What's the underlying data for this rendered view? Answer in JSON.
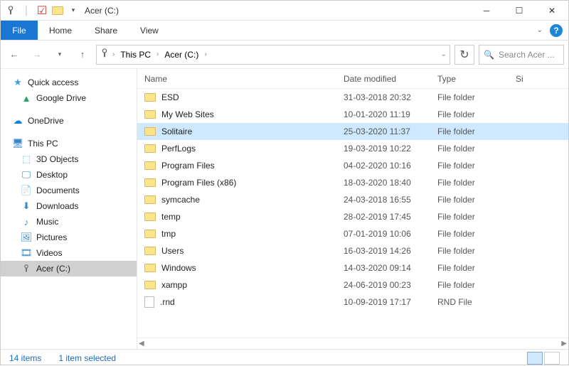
{
  "window": {
    "title": "Acer (C:)"
  },
  "ribbon": {
    "file": "File",
    "tabs": [
      "Home",
      "Share",
      "View"
    ]
  },
  "breadcrumb": {
    "items": [
      "This PC",
      "Acer (C:)"
    ]
  },
  "search": {
    "placeholder": "Search Acer ..."
  },
  "sidebar": {
    "quick_access": "Quick access",
    "google_drive": "Google Drive",
    "onedrive": "OneDrive",
    "this_pc": "This PC",
    "items": [
      "3D Objects",
      "Desktop",
      "Documents",
      "Downloads",
      "Music",
      "Pictures",
      "Videos",
      "Acer (C:)"
    ]
  },
  "columns": {
    "name": "Name",
    "date": "Date modified",
    "type": "Type",
    "size": "Si"
  },
  "files": [
    {
      "name": "ESD",
      "date": "31-03-2018 20:32",
      "type": "File folder",
      "icon": "folder",
      "selected": false
    },
    {
      "name": "My Web Sites",
      "date": "10-01-2020 11:19",
      "type": "File folder",
      "icon": "folder",
      "selected": false
    },
    {
      "name": "Solitaire",
      "date": "25-03-2020 11:37",
      "type": "File folder",
      "icon": "folder",
      "selected": true
    },
    {
      "name": "PerfLogs",
      "date": "19-03-2019 10:22",
      "type": "File folder",
      "icon": "folder",
      "selected": false
    },
    {
      "name": "Program Files",
      "date": "04-02-2020 10:16",
      "type": "File folder",
      "icon": "folder",
      "selected": false
    },
    {
      "name": "Program Files (x86)",
      "date": "18-03-2020 18:40",
      "type": "File folder",
      "icon": "folder",
      "selected": false
    },
    {
      "name": "symcache",
      "date": "24-03-2018 16:55",
      "type": "File folder",
      "icon": "folder",
      "selected": false
    },
    {
      "name": "temp",
      "date": "28-02-2019 17:45",
      "type": "File folder",
      "icon": "folder",
      "selected": false
    },
    {
      "name": "tmp",
      "date": "07-01-2019 10:06",
      "type": "File folder",
      "icon": "folder",
      "selected": false
    },
    {
      "name": "Users",
      "date": "16-03-2019 14:26",
      "type": "File folder",
      "icon": "folder",
      "selected": false
    },
    {
      "name": "Windows",
      "date": "14-03-2020 09:14",
      "type": "File folder",
      "icon": "folder",
      "selected": false
    },
    {
      "name": "xampp",
      "date": "24-06-2019 00:23",
      "type": "File folder",
      "icon": "folder",
      "selected": false
    },
    {
      "name": ".rnd",
      "date": "10-09-2019 17:17",
      "type": "RND File",
      "icon": "file",
      "selected": false
    }
  ],
  "status": {
    "items": "14 items",
    "selected": "1 item selected"
  }
}
